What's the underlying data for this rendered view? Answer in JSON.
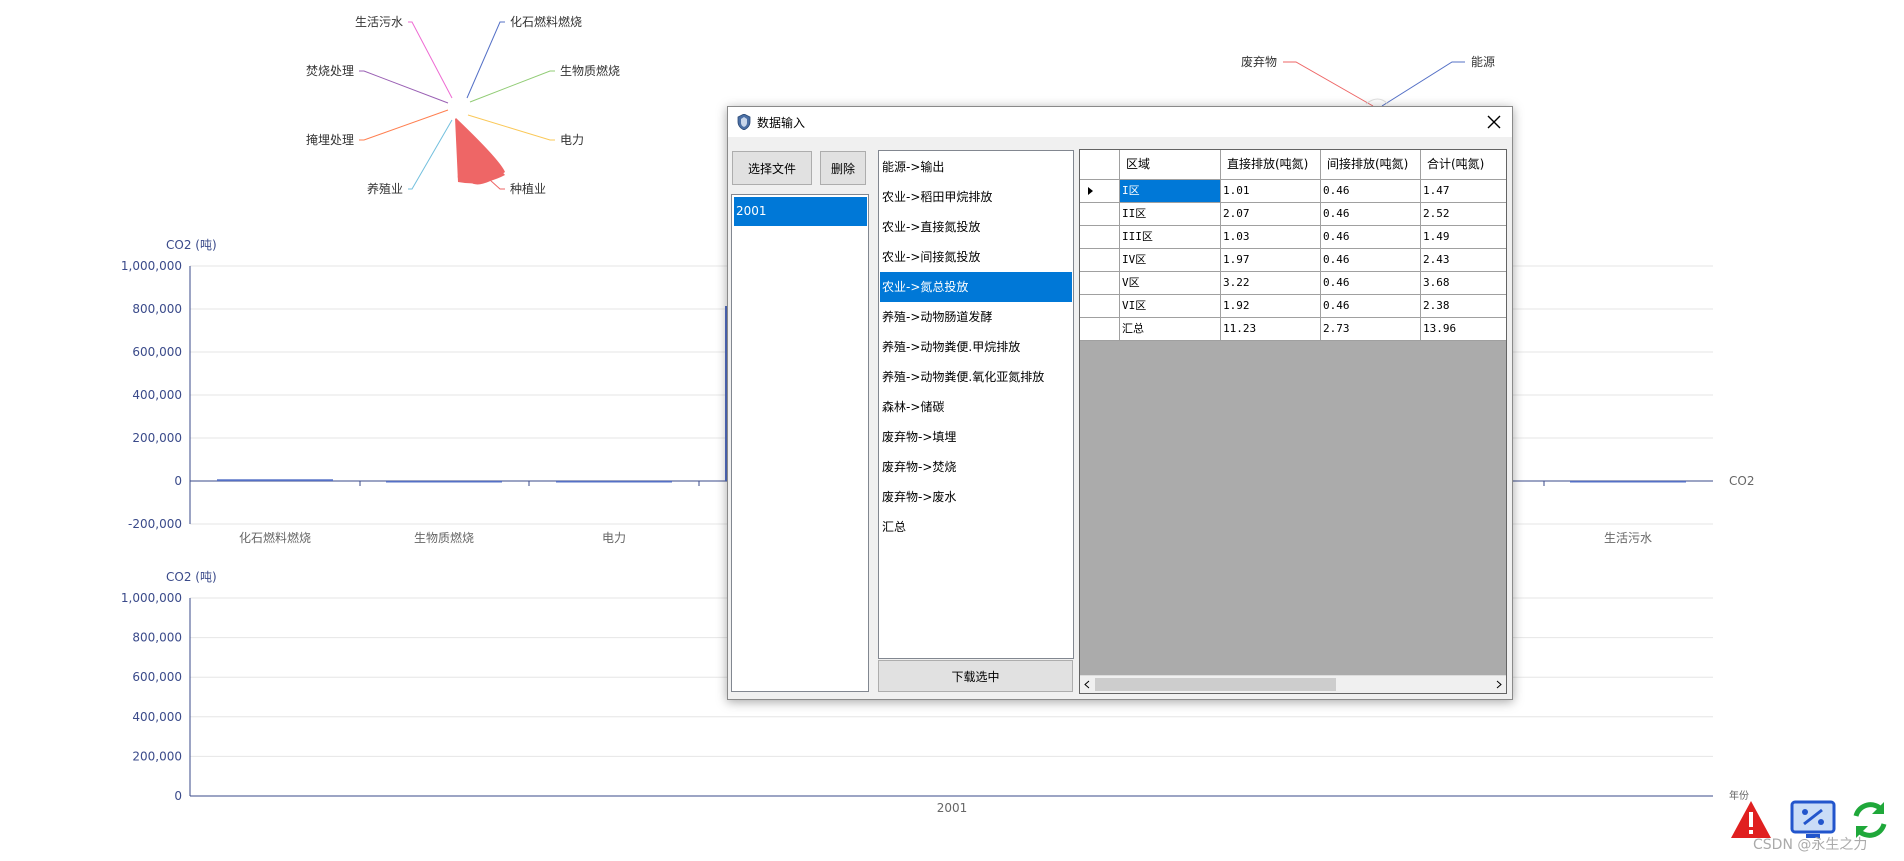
{
  "pie_chart": {
    "labels": [
      "生活污水",
      "化石燃料燃烧",
      "焚烧处理",
      "生物质燃烧",
      "掩埋处理",
      "电力",
      "养殖业",
      "种植业"
    ],
    "colors": [
      "#ee6bd3",
      "#5470c6",
      "#9a60b4",
      "#91cc75",
      "#ff7f50",
      "#fac858",
      "#73c0de",
      "#ee6666"
    ]
  },
  "pie_chart_2": {
    "labels": [
      "废弃物",
      "能源"
    ],
    "colors": [
      "#ee6666",
      "#5470c6"
    ]
  },
  "chart_data": [
    {
      "type": "bar",
      "title": "",
      "ylabel": "CO2 (吨)",
      "y_ticks": [
        "1,000,000",
        "800,000",
        "600,000",
        "400,000",
        "200,000",
        "0",
        "-200,000"
      ],
      "ylim": [
        -200000,
        1000000
      ],
      "categories": [
        "化石燃料燃烧",
        "生物质燃烧",
        "电力",
        "生活污水"
      ],
      "series": [
        {
          "name": "CO2",
          "values": [
            8000,
            0,
            0,
            0
          ]
        }
      ],
      "legend": "CO2"
    },
    {
      "type": "bar",
      "title": "",
      "ylabel": "CO2 (吨)",
      "xlabel": "年份",
      "y_ticks": [
        "1,000,000",
        "800,000",
        "600,000",
        "400,000",
        "200,000",
        "0"
      ],
      "ylim": [
        0,
        1000000
      ],
      "categories": [
        "2001"
      ]
    }
  ],
  "dialog": {
    "title": "数据输入",
    "select_file": "选择文件",
    "delete": "删除",
    "download_selected": "下载选中",
    "years": [
      "2001"
    ],
    "categories": [
      "能源->输出",
      "农业->稻田甲烷排放",
      "农业->直接氮投放",
      "农业->间接氮投放",
      "农业->氮总投放",
      "养殖->动物肠道发酵",
      "养殖->动物粪便.甲烷排放",
      "养殖->动物粪便.氧化亚氮排放",
      "森林->储碳",
      "废弃物->填埋",
      "废弃物->焚烧",
      "废弃物->废水",
      "汇总"
    ],
    "selected_category": "农业->氮总投放",
    "grid": {
      "headers": [
        "区域",
        "直接排放(吨氮)",
        "间接排放(吨氮)",
        "合计(吨氮)"
      ],
      "rows": [
        [
          "I区",
          "1.01",
          "0.46",
          "1.47"
        ],
        [
          "II区",
          "2.07",
          "0.46",
          "2.52"
        ],
        [
          "III区",
          "1.03",
          "0.46",
          "1.49"
        ],
        [
          "IV区",
          "1.97",
          "0.46",
          "2.43"
        ],
        [
          "V区",
          "3.22",
          "0.46",
          "3.68"
        ],
        [
          "VI区",
          "1.92",
          "0.46",
          "2.38"
        ],
        [
          "汇总",
          "11.23",
          "2.73",
          "13.96"
        ]
      ]
    }
  },
  "watermark": "CSDN @永生之力",
  "taskbar_icons": [
    "warning-icon",
    "display-settings-icon",
    "refresh-icon"
  ]
}
